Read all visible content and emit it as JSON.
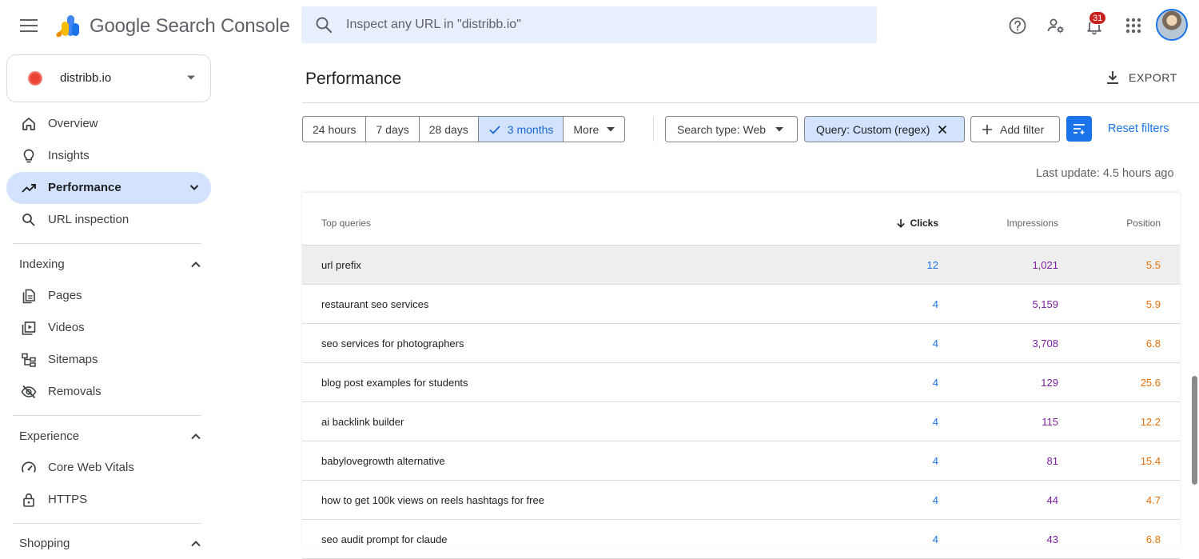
{
  "header": {
    "app_name": "Google Search Console",
    "search_placeholder": "Inspect any URL in \"distribb.io\"",
    "notification_count": "31"
  },
  "property": {
    "name": "distribb.io"
  },
  "sidebar": {
    "top_items": [
      {
        "label": "Overview",
        "icon": "home-icon"
      },
      {
        "label": "Insights",
        "icon": "lightbulb-icon"
      },
      {
        "label": "Performance",
        "icon": "trending-up-icon",
        "active": true
      },
      {
        "label": "URL inspection",
        "icon": "search-icon"
      }
    ],
    "sections": [
      {
        "title": "Indexing",
        "items": [
          {
            "label": "Pages",
            "icon": "pages-icon"
          },
          {
            "label": "Videos",
            "icon": "video-icon"
          },
          {
            "label": "Sitemaps",
            "icon": "sitemap-icon"
          },
          {
            "label": "Removals",
            "icon": "visibility-off-icon"
          }
        ]
      },
      {
        "title": "Experience",
        "items": [
          {
            "label": "Core Web Vitals",
            "icon": "speed-icon"
          },
          {
            "label": "HTTPS",
            "icon": "lock-icon"
          }
        ]
      },
      {
        "title": "Shopping",
        "items": []
      }
    ]
  },
  "main": {
    "title": "Performance",
    "export_label": "EXPORT",
    "date_ranges": [
      "24 hours",
      "7 days",
      "28 days",
      "3 months",
      "More"
    ],
    "selected_range": "3 months",
    "search_type": "Search type: Web",
    "query_filter": "Query: Custom (regex)",
    "add_filter": "Add filter",
    "reset_filters": "Reset filters",
    "last_update": "Last update: 4.5 hours ago"
  },
  "table": {
    "headers": {
      "query": "Top queries",
      "clicks": "Clicks",
      "impressions": "Impressions",
      "position": "Position"
    },
    "rows": [
      {
        "query": "url prefix",
        "clicks": "12",
        "impressions": "1,021",
        "position": "5.5"
      },
      {
        "query": "restaurant seo services",
        "clicks": "4",
        "impressions": "5,159",
        "position": "5.9"
      },
      {
        "query": "seo services for photographers",
        "clicks": "4",
        "impressions": "3,708",
        "position": "6.8"
      },
      {
        "query": "blog post examples for students",
        "clicks": "4",
        "impressions": "129",
        "position": "25.6"
      },
      {
        "query": "ai backlink builder",
        "clicks": "4",
        "impressions": "115",
        "position": "12.2"
      },
      {
        "query": "babylovegrowth alternative",
        "clicks": "4",
        "impressions": "81",
        "position": "15.4"
      },
      {
        "query": "how to get 100k views on reels hashtags for free",
        "clicks": "4",
        "impressions": "44",
        "position": "4.7"
      },
      {
        "query": "seo audit prompt for claude",
        "clicks": "4",
        "impressions": "43",
        "position": "6.8"
      }
    ]
  },
  "colors": {
    "accent": "#1a73e8",
    "clicks": "#1a73e8",
    "impressions": "#7b1fa2",
    "position": "#e8710a",
    "active_nav": "#d3e3fd"
  }
}
